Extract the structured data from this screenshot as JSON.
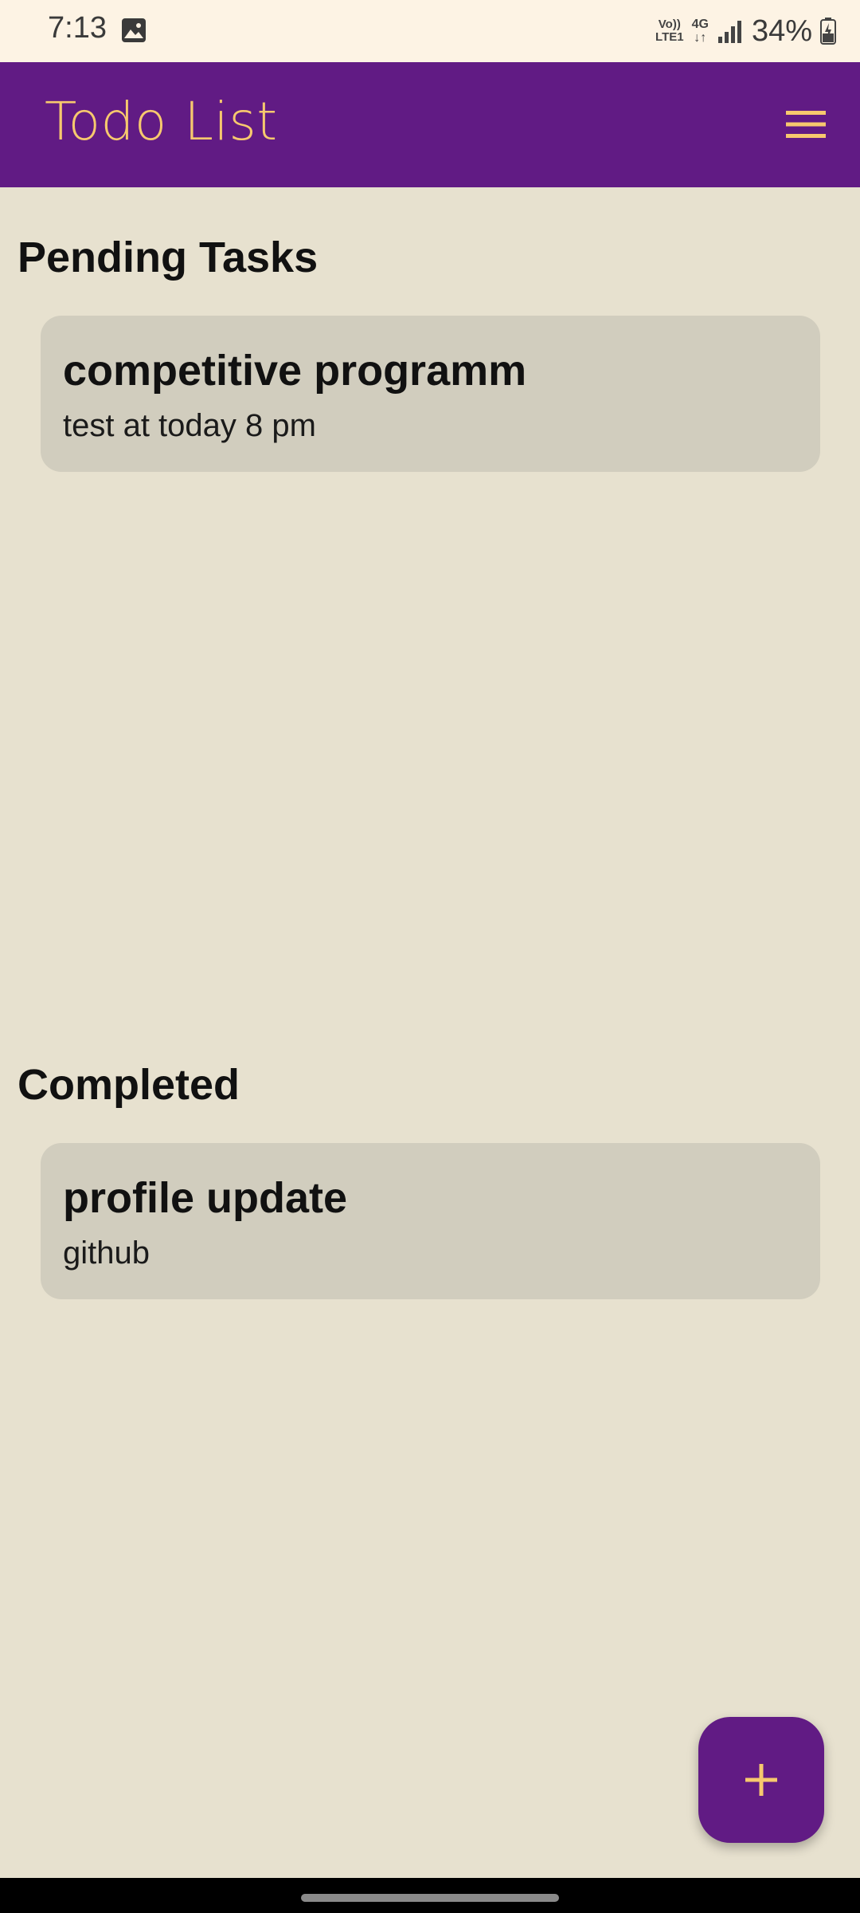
{
  "status_bar": {
    "time": "7:13",
    "volte_top": "Vo))",
    "volte_bottom": "LTE1",
    "network_top": "4G",
    "network_arrows": "↓↑",
    "battery": "34%",
    "icons": [
      "gallery-icon",
      "signal-icon",
      "battery-icon"
    ]
  },
  "app_bar": {
    "title": "Todo List",
    "menu_icon": "hamburger-menu-icon"
  },
  "pending": {
    "heading": "Pending Tasks",
    "tasks": [
      {
        "title": "competitive programm",
        "description": "test at today 8 pm"
      }
    ]
  },
  "completed": {
    "heading": "Completed",
    "tasks": [
      {
        "title": "profile update",
        "description": "github"
      }
    ]
  },
  "fab": {
    "icon": "plus-icon"
  },
  "colors": {
    "primary": "#611b84",
    "accent": "#f7c96e",
    "background": "#e7e1cf",
    "card": "#d1cdbe",
    "status_bar": "#fdf3e4"
  }
}
